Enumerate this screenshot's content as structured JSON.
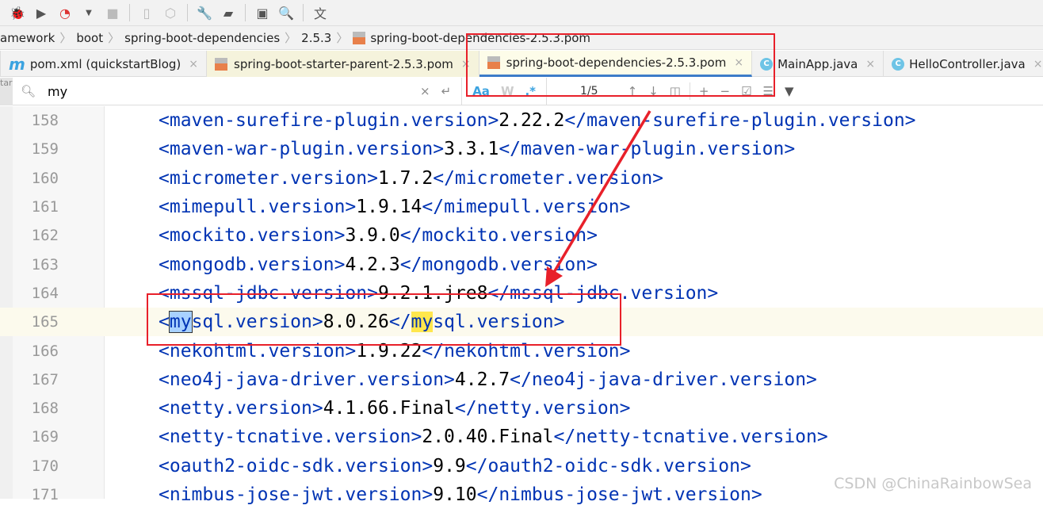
{
  "toolbar": {
    "icons": [
      "debug-icon",
      "coverage-icon",
      "profile-icon",
      "dropdown-icon",
      "stop-icon",
      "device-icon",
      "deploy-icon",
      "wrench-icon",
      "project-structure-icon",
      "terminal-icon",
      "search-icon",
      "translate-icon"
    ]
  },
  "breadcrumb": [
    "amework",
    "boot",
    "spring-boot-dependencies",
    "2.5.3",
    "spring-boot-dependencies-2.5.3.pom"
  ],
  "tabs": [
    {
      "label": "pom.xml (quickstartBlog)",
      "icon": "m"
    },
    {
      "label": "spring-boot-starter-parent-2.5.3.pom"
    },
    {
      "label": "spring-boot-dependencies-2.5.3.pom"
    },
    {
      "label": "MainApp.java",
      "icon": "C"
    },
    {
      "label": "HelloController.java",
      "icon": "C"
    }
  ],
  "search": {
    "value": "my",
    "case_label": "Aa",
    "word_label": "W",
    "regex_label": ".*",
    "match_count": "1/5",
    "left_stub": "tar"
  },
  "lines": [
    {
      "n": "158",
      "tag": "maven-surefire-plugin.version",
      "value": "2.22.2"
    },
    {
      "n": "159",
      "tag": "maven-war-plugin.version",
      "value": "3.3.1"
    },
    {
      "n": "160",
      "tag": "micrometer.version",
      "value": "1.7.2"
    },
    {
      "n": "161",
      "tag": "mimepull.version",
      "value": "1.9.14"
    },
    {
      "n": "162",
      "tag": "mockito.version",
      "value": "3.9.0"
    },
    {
      "n": "163",
      "tag": "mongodb.version",
      "value": "4.2.3"
    },
    {
      "n": "164",
      "tag": "mssql-jdbc.version",
      "value": "9.2.1.jre8"
    },
    {
      "n": "165",
      "tag": "mysql.version",
      "value": "8.0.26"
    },
    {
      "n": "166",
      "tag": "nekohtml.version",
      "value": "1.9.22"
    },
    {
      "n": "167",
      "tag": "neo4j-java-driver.version",
      "value": "4.2.7"
    },
    {
      "n": "168",
      "tag": "netty.version",
      "value": "4.1.66.Final"
    },
    {
      "n": "169",
      "tag": "netty-tcnative.version",
      "value": "2.0.40.Final"
    },
    {
      "n": "170",
      "tag": "oauth2-oidc-sdk.version",
      "value": "9.9"
    },
    {
      "n": "171",
      "tag": "nimbus-jose-jwt.version",
      "value": "9.10"
    }
  ],
  "current_line": "165",
  "watermark": "CSDN @ChinaRainbowSea",
  "colors": {
    "tag": "#0033b3",
    "annotation": "#e8202a",
    "current_match": "#a8d1ff",
    "match": "#ffe74d"
  }
}
